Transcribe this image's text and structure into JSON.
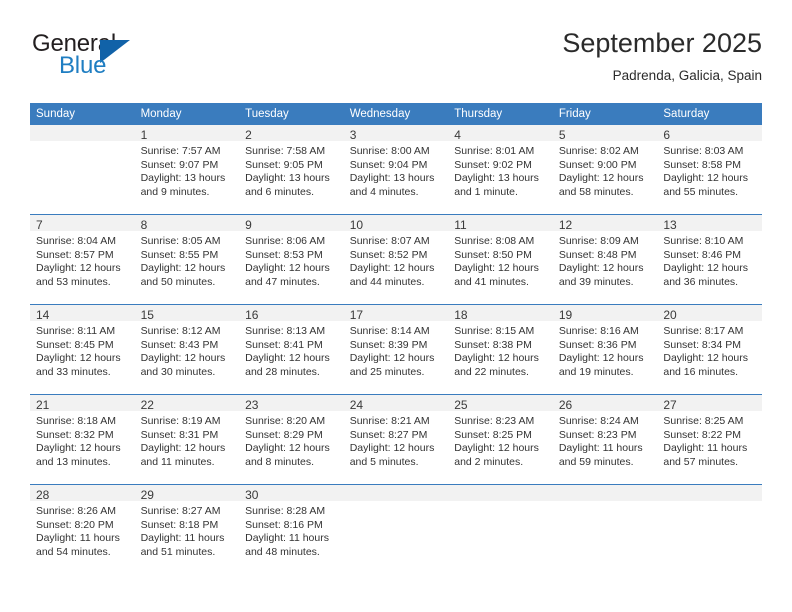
{
  "brand": {
    "name_part1": "General",
    "name_part2": "Blue",
    "triangle_color": "#1162a8",
    "blue_text_color": "#1f7ec2"
  },
  "header": {
    "title": "September 2025",
    "subtitle": "Padrenda, Galicia, Spain",
    "accent_color": "#3a7cbe"
  },
  "weekdays": [
    "Sunday",
    "Monday",
    "Tuesday",
    "Wednesday",
    "Thursday",
    "Friday",
    "Saturday"
  ],
  "weeks": [
    [
      {
        "day": ""
      },
      {
        "day": "1",
        "sunrise": "Sunrise: 7:57 AM",
        "sunset": "Sunset: 9:07 PM",
        "daylight": "Daylight: 13 hours and 9 minutes."
      },
      {
        "day": "2",
        "sunrise": "Sunrise: 7:58 AM",
        "sunset": "Sunset: 9:05 PM",
        "daylight": "Daylight: 13 hours and 6 minutes."
      },
      {
        "day": "3",
        "sunrise": "Sunrise: 8:00 AM",
        "sunset": "Sunset: 9:04 PM",
        "daylight": "Daylight: 13 hours and 4 minutes."
      },
      {
        "day": "4",
        "sunrise": "Sunrise: 8:01 AM",
        "sunset": "Sunset: 9:02 PM",
        "daylight": "Daylight: 13 hours and 1 minute."
      },
      {
        "day": "5",
        "sunrise": "Sunrise: 8:02 AM",
        "sunset": "Sunset: 9:00 PM",
        "daylight": "Daylight: 12 hours and 58 minutes."
      },
      {
        "day": "6",
        "sunrise": "Sunrise: 8:03 AM",
        "sunset": "Sunset: 8:58 PM",
        "daylight": "Daylight: 12 hours and 55 minutes."
      }
    ],
    [
      {
        "day": "7",
        "sunrise": "Sunrise: 8:04 AM",
        "sunset": "Sunset: 8:57 PM",
        "daylight": "Daylight: 12 hours and 53 minutes."
      },
      {
        "day": "8",
        "sunrise": "Sunrise: 8:05 AM",
        "sunset": "Sunset: 8:55 PM",
        "daylight": "Daylight: 12 hours and 50 minutes."
      },
      {
        "day": "9",
        "sunrise": "Sunrise: 8:06 AM",
        "sunset": "Sunset: 8:53 PM",
        "daylight": "Daylight: 12 hours and 47 minutes."
      },
      {
        "day": "10",
        "sunrise": "Sunrise: 8:07 AM",
        "sunset": "Sunset: 8:52 PM",
        "daylight": "Daylight: 12 hours and 44 minutes."
      },
      {
        "day": "11",
        "sunrise": "Sunrise: 8:08 AM",
        "sunset": "Sunset: 8:50 PM",
        "daylight": "Daylight: 12 hours and 41 minutes."
      },
      {
        "day": "12",
        "sunrise": "Sunrise: 8:09 AM",
        "sunset": "Sunset: 8:48 PM",
        "daylight": "Daylight: 12 hours and 39 minutes."
      },
      {
        "day": "13",
        "sunrise": "Sunrise: 8:10 AM",
        "sunset": "Sunset: 8:46 PM",
        "daylight": "Daylight: 12 hours and 36 minutes."
      }
    ],
    [
      {
        "day": "14",
        "sunrise": "Sunrise: 8:11 AM",
        "sunset": "Sunset: 8:45 PM",
        "daylight": "Daylight: 12 hours and 33 minutes."
      },
      {
        "day": "15",
        "sunrise": "Sunrise: 8:12 AM",
        "sunset": "Sunset: 8:43 PM",
        "daylight": "Daylight: 12 hours and 30 minutes."
      },
      {
        "day": "16",
        "sunrise": "Sunrise: 8:13 AM",
        "sunset": "Sunset: 8:41 PM",
        "daylight": "Daylight: 12 hours and 28 minutes."
      },
      {
        "day": "17",
        "sunrise": "Sunrise: 8:14 AM",
        "sunset": "Sunset: 8:39 PM",
        "daylight": "Daylight: 12 hours and 25 minutes."
      },
      {
        "day": "18",
        "sunrise": "Sunrise: 8:15 AM",
        "sunset": "Sunset: 8:38 PM",
        "daylight": "Daylight: 12 hours and 22 minutes."
      },
      {
        "day": "19",
        "sunrise": "Sunrise: 8:16 AM",
        "sunset": "Sunset: 8:36 PM",
        "daylight": "Daylight: 12 hours and 19 minutes."
      },
      {
        "day": "20",
        "sunrise": "Sunrise: 8:17 AM",
        "sunset": "Sunset: 8:34 PM",
        "daylight": "Daylight: 12 hours and 16 minutes."
      }
    ],
    [
      {
        "day": "21",
        "sunrise": "Sunrise: 8:18 AM",
        "sunset": "Sunset: 8:32 PM",
        "daylight": "Daylight: 12 hours and 13 minutes."
      },
      {
        "day": "22",
        "sunrise": "Sunrise: 8:19 AM",
        "sunset": "Sunset: 8:31 PM",
        "daylight": "Daylight: 12 hours and 11 minutes."
      },
      {
        "day": "23",
        "sunrise": "Sunrise: 8:20 AM",
        "sunset": "Sunset: 8:29 PM",
        "daylight": "Daylight: 12 hours and 8 minutes."
      },
      {
        "day": "24",
        "sunrise": "Sunrise: 8:21 AM",
        "sunset": "Sunset: 8:27 PM",
        "daylight": "Daylight: 12 hours and 5 minutes."
      },
      {
        "day": "25",
        "sunrise": "Sunrise: 8:23 AM",
        "sunset": "Sunset: 8:25 PM",
        "daylight": "Daylight: 12 hours and 2 minutes."
      },
      {
        "day": "26",
        "sunrise": "Sunrise: 8:24 AM",
        "sunset": "Sunset: 8:23 PM",
        "daylight": "Daylight: 11 hours and 59 minutes."
      },
      {
        "day": "27",
        "sunrise": "Sunrise: 8:25 AM",
        "sunset": "Sunset: 8:22 PM",
        "daylight": "Daylight: 11 hours and 57 minutes."
      }
    ],
    [
      {
        "day": "28",
        "sunrise": "Sunrise: 8:26 AM",
        "sunset": "Sunset: 8:20 PM",
        "daylight": "Daylight: 11 hours and 54 minutes."
      },
      {
        "day": "29",
        "sunrise": "Sunrise: 8:27 AM",
        "sunset": "Sunset: 8:18 PM",
        "daylight": "Daylight: 11 hours and 51 minutes."
      },
      {
        "day": "30",
        "sunrise": "Sunrise: 8:28 AM",
        "sunset": "Sunset: 8:16 PM",
        "daylight": "Daylight: 11 hours and 48 minutes."
      },
      {
        "day": ""
      },
      {
        "day": ""
      },
      {
        "day": ""
      },
      {
        "day": ""
      }
    ]
  ]
}
